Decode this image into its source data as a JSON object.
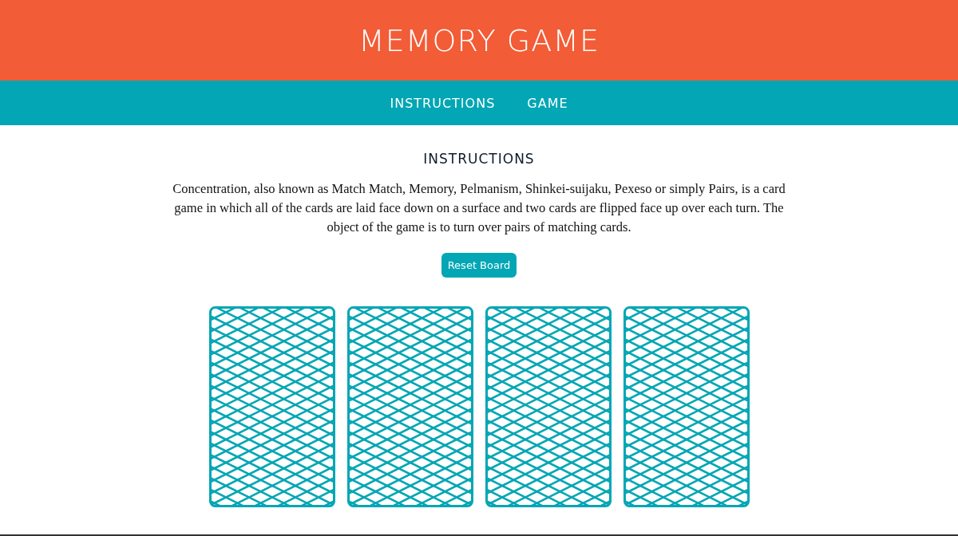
{
  "header": {
    "title": "MEMORY GAME"
  },
  "nav": [
    {
      "label": "INSTRUCTIONS"
    },
    {
      "label": "GAME"
    }
  ],
  "instructions": {
    "heading": "INSTRUCTIONS",
    "text": "Concentration, also known as Match Match, Memory, Pelmanism, Shinkei-suijaku, Pexeso or simply Pairs, is a card game in which all of the cards are laid face down on a surface and two cards are flipped face up over each turn. The object of the game is to turn over pairs of matching cards."
  },
  "reset_button": "Reset Board",
  "cards": [
    {
      "face_down": true
    },
    {
      "face_down": true
    },
    {
      "face_down": true
    },
    {
      "face_down": true
    }
  ]
}
